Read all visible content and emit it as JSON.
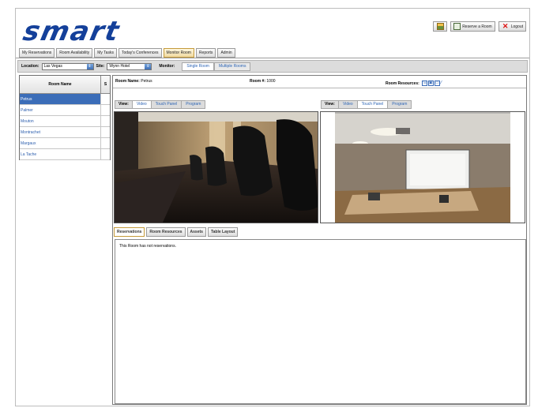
{
  "app": {
    "logo": "smart"
  },
  "header_buttons": {
    "reserve": "Reserve a Room",
    "logout": "Logout"
  },
  "tabs": [
    {
      "label": "My Reservations"
    },
    {
      "label": "Room Availability"
    },
    {
      "label": "My Tasks"
    },
    {
      "label": "Today's Conferences"
    },
    {
      "label": "Monitor Room",
      "active": true
    },
    {
      "label": "Reports"
    },
    {
      "label": "Admin"
    }
  ],
  "filters": {
    "location_label": "Location:",
    "location_value": "Las Vegas",
    "site_label": "Site:",
    "site_value": "Wynn Hotel",
    "monitor_label": "Monitor:",
    "single": "Single Room",
    "multiple": "Multiple Rooms"
  },
  "room_list": {
    "col_name": "Room Name",
    "col_s": "S",
    "rows": [
      "Petrus",
      "Palmer",
      "Mouton",
      "Montrachet",
      "Margaux",
      "La Tache"
    ],
    "selected_index": 0
  },
  "room_info": {
    "name_label": "Room Name:",
    "name_value": "Petrus",
    "num_label": "Room #:",
    "num_value": "1000",
    "resources_label": "Room Resources:"
  },
  "views": [
    {
      "label": "View:",
      "video": "Video",
      "touch": "Touch Panel",
      "program": "Program",
      "active": "video"
    },
    {
      "label": "View:",
      "video": "Video",
      "touch": "Touch Panel",
      "program": "Program",
      "active": "touch"
    }
  ],
  "bottom_tabs": [
    {
      "label": "Reservations",
      "active": true
    },
    {
      "label": "Room Resources"
    },
    {
      "label": "Assets"
    },
    {
      "label": "Table Layout"
    }
  ],
  "content": {
    "message": "This Room has not reservations."
  },
  "colors": {
    "brand": "#14409a",
    "selection": "#3b6db8",
    "link": "#2b63b4",
    "active_tab": "#f0d9a0"
  }
}
